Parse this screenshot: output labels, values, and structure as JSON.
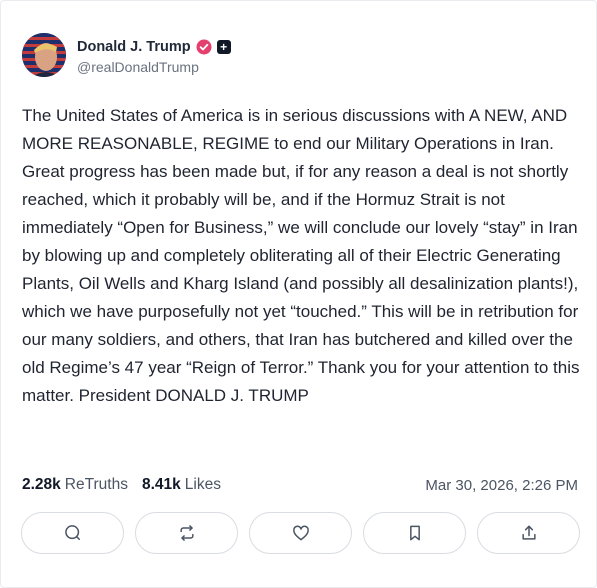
{
  "author": {
    "display_name": "Donald J. Trump",
    "handle": "@realDonaldTrump",
    "plus_badge": "+"
  },
  "post": {
    "text": "The United States of America is in serious discussions with A NEW, AND MORE REASONABLE, REGIME to end our Military Operations in Iran. Great progress has been made but, if for any reason a deal is not shortly reached, which it probably will be, and if the Hormuz Strait is not immediately “Open for Business,” we will conclude our lovely “stay” in Iran by blowing up and completely obliterating all of their Electric Generating Plants, Oil Wells and Kharg Island (and possibly all desalinization plants!), which we have purposefully not yet “touched.” This will be in retribution for our many soldiers, and others, that Iran has butchered and killed over the old Regime’s 47 year “Reign of Terror.” Thank you for your attention to this matter. President DONALD J. TRUMP"
  },
  "stats": {
    "retruths_count": "2.28k",
    "retruths_label": "ReTruths",
    "likes_count": "8.41k",
    "likes_label": "Likes",
    "timestamp": "Mar 30, 2026, 2:26 PM"
  },
  "actions": [
    {
      "icon": "reply-icon"
    },
    {
      "icon": "retruth-icon"
    },
    {
      "icon": "heart-icon"
    },
    {
      "icon": "bookmark-icon"
    },
    {
      "icon": "share-icon"
    }
  ],
  "colors": {
    "verified": "#e4406f",
    "text": "#1f2430",
    "muted": "#4b5563",
    "border": "#d9dce1"
  }
}
